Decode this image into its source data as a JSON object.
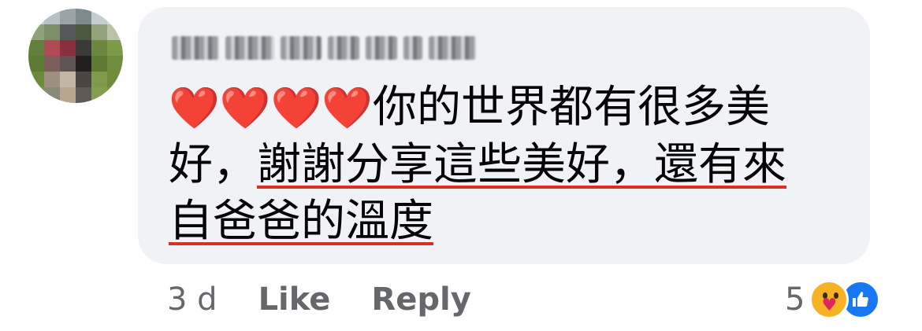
{
  "comment": {
    "line1_hearts": "❤️❤️❤️❤️",
    "line1_text": "你的世界都有很多美",
    "line2_plain": "好，",
    "line2_underlined": "謝謝分享這些美好，還有來",
    "line3_underlined": "自爸爸的溫度"
  },
  "actions": {
    "time": "3 d",
    "like_label": "Like",
    "reply_label": "Reply"
  },
  "reactions": {
    "count": "5",
    "icons": [
      "care-reaction",
      "like-reaction"
    ]
  },
  "colors": {
    "bubble_bg": "#f0f2f5",
    "secondary_text": "#65676b",
    "like_blue": "#1877f2",
    "underline_red": "#d93025"
  }
}
